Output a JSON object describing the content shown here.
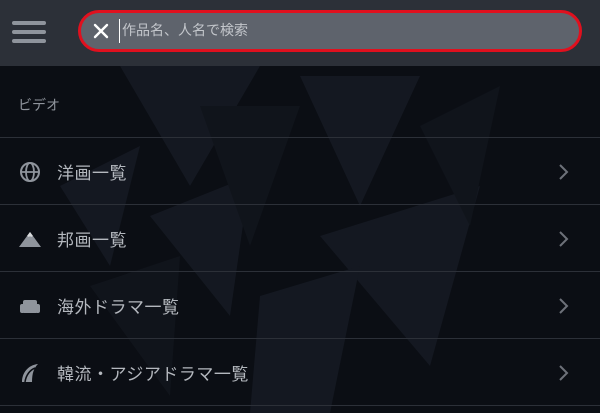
{
  "search": {
    "placeholder": "作品名、人名で検索",
    "value": ""
  },
  "section": {
    "title": "ビデオ"
  },
  "menu": {
    "items": [
      {
        "label": "洋画一覧",
        "icon": "globe-icon"
      },
      {
        "label": "邦画一覧",
        "icon": "mountain-icon"
      },
      {
        "label": "海外ドラマ一覧",
        "icon": "sofa-icon"
      },
      {
        "label": "韓流・アジアドラマ一覧",
        "icon": "fan-icon"
      }
    ]
  },
  "colors": {
    "accent": "#e0101e",
    "header_bg": "#2c3038",
    "page_bg": "#0b0e14"
  }
}
